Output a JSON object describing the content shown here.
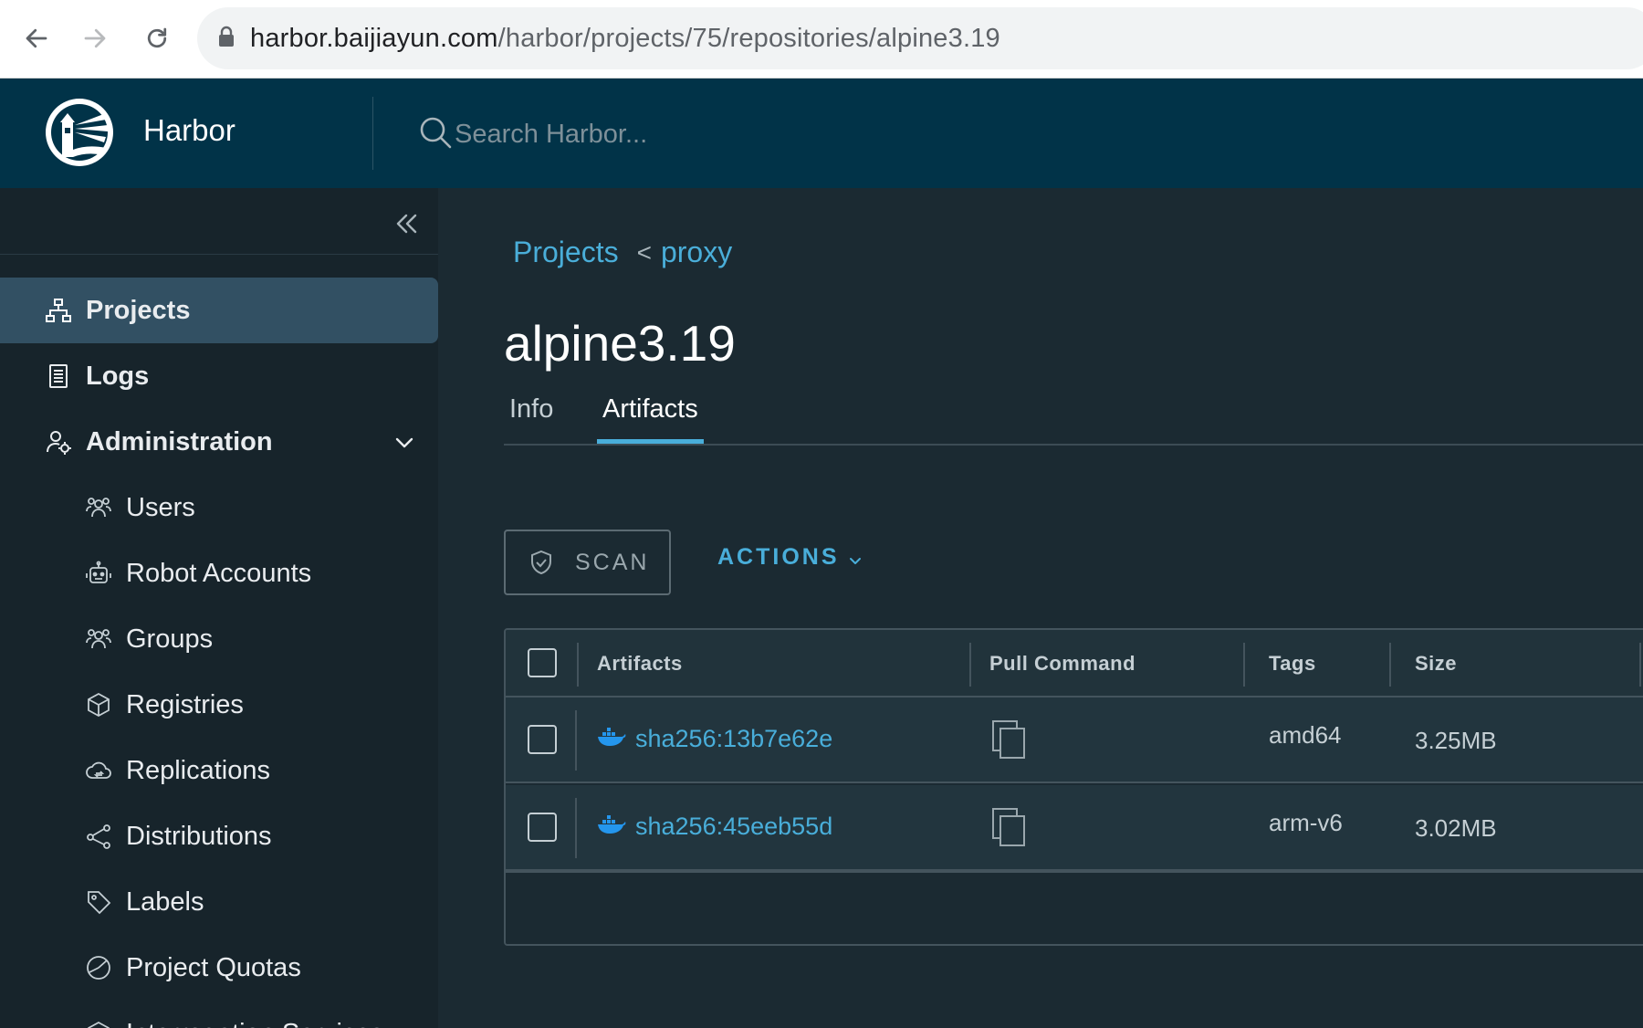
{
  "browser": {
    "url_host": "harbor.baijiayun.com",
    "url_path": "/harbor/projects/75/repositories/alpine3.19"
  },
  "header": {
    "brand": "Harbor",
    "search_placeholder": "Search Harbor..."
  },
  "sidebar": {
    "items": [
      {
        "label": "Projects",
        "icon": "projects-icon",
        "active": true
      },
      {
        "label": "Logs",
        "icon": "logs-icon"
      },
      {
        "label": "Administration",
        "icon": "administration-icon",
        "expanded": true
      }
    ],
    "admin_items": [
      {
        "label": "Users",
        "icon": "users-icon"
      },
      {
        "label": "Robot Accounts",
        "icon": "robot-icon"
      },
      {
        "label": "Groups",
        "icon": "groups-icon"
      },
      {
        "label": "Registries",
        "icon": "registries-icon"
      },
      {
        "label": "Replications",
        "icon": "replications-icon"
      },
      {
        "label": "Distributions",
        "icon": "distributions-icon"
      },
      {
        "label": "Labels",
        "icon": "labels-icon"
      },
      {
        "label": "Project Quotas",
        "icon": "quotas-icon"
      },
      {
        "label": "Interrogation Services",
        "icon": "interrogation-icon"
      }
    ]
  },
  "breadcrumb": {
    "root": "Projects",
    "separator": "<",
    "project": "proxy"
  },
  "page": {
    "title": "alpine3.19",
    "tabs": [
      {
        "label": "Info",
        "active": false
      },
      {
        "label": "Artifacts",
        "active": true
      }
    ]
  },
  "toolbar": {
    "scan_label": "SCAN",
    "actions_label": "ACTIONS"
  },
  "table": {
    "columns": [
      "Artifacts",
      "Pull Command",
      "Tags",
      "Size"
    ],
    "rows": [
      {
        "digest": "sha256:13b7e62e",
        "tag": "amd64",
        "size": "3.25MB"
      },
      {
        "digest": "sha256:45eeb55d",
        "tag": "arm-v6",
        "size": "3.02MB"
      }
    ]
  },
  "colors": {
    "header_bg": "#013348",
    "sidebar_bg": "#17242b",
    "main_bg": "#1b2a32",
    "accent": "#49aeda",
    "active_nav": "#325063"
  }
}
